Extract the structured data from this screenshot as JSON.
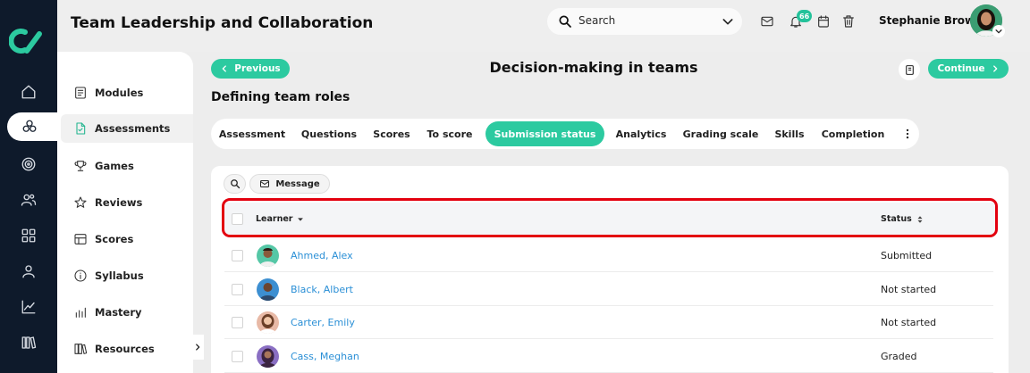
{
  "app": {
    "title": "Team Leadership and Collaboration"
  },
  "header": {
    "search_placeholder": "Search",
    "notification_count": "66",
    "user_name": "Stephanie Brown"
  },
  "rail": {
    "icons": [
      "home-icon",
      "network-icon",
      "target-icon",
      "people-icon",
      "grid-icon",
      "user-icon",
      "chart-icon",
      "library-icon"
    ]
  },
  "subnav": {
    "items": [
      {
        "label": "Modules",
        "icon": "modules-icon"
      },
      {
        "label": "Assessments",
        "icon": "assessment-icon"
      },
      {
        "label": "Games",
        "icon": "trophy-icon"
      },
      {
        "label": "Reviews",
        "icon": "star-icon"
      },
      {
        "label": "Scores",
        "icon": "scores-icon"
      },
      {
        "label": "Syllabus",
        "icon": "info-icon"
      },
      {
        "label": "Mastery",
        "icon": "bars-icon"
      },
      {
        "label": "Resources",
        "icon": "books-icon"
      }
    ]
  },
  "page": {
    "previous_label": "Previous",
    "continue_label": "Continue",
    "heading": "Decision-making in teams",
    "section_title": "Defining team roles"
  },
  "tabs": [
    {
      "label": "Assessment"
    },
    {
      "label": "Questions"
    },
    {
      "label": "Scores"
    },
    {
      "label": "To score"
    },
    {
      "label": "Submission status"
    },
    {
      "label": "Analytics"
    },
    {
      "label": "Grading scale"
    },
    {
      "label": "Skills"
    },
    {
      "label": "Completion"
    }
  ],
  "toolbar": {
    "message_label": "Message"
  },
  "table": {
    "headers": {
      "learner": "Learner",
      "status": "Status"
    },
    "rows": [
      {
        "name": "Ahmed, Alex",
        "status": "Submitted"
      },
      {
        "name": "Black, Albert",
        "status": "Not started"
      },
      {
        "name": "Carter, Emily",
        "status": "Not started"
      },
      {
        "name": "Cass, Meghan",
        "status": "Graded"
      }
    ]
  },
  "colors": {
    "accent": "#2ccaa0",
    "rail": "#0e1a2b",
    "link": "#2a8fd6",
    "highlight": "#e3000f"
  }
}
